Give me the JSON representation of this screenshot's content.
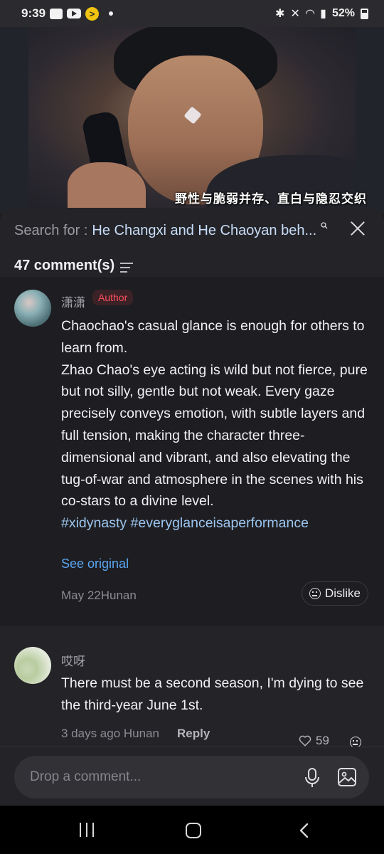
{
  "status_bar": {
    "time": "9:39",
    "battery": "52%"
  },
  "video": {
    "caption": "野性与脆弱并存、直白与隐忍交织"
  },
  "search": {
    "prefix": "Search for :",
    "query": "He Changxi and He Chaoyan beh..."
  },
  "comments_header": {
    "count_label": "47 comment(s)"
  },
  "comments": [
    {
      "username": "潇潇",
      "badge": "Author",
      "paragraph1": "Chaochao's casual glance is enough for others to learn from.",
      "paragraph2": "Zhao Chao's eye acting is wild but not fierce, pure but not silly, gentle but not weak. Every gaze precisely conveys emotion, with subtle layers and full tension, making the character three-dimensional and vibrant, and also elevating the tug-of-war and atmosphere in the scenes with his co-stars to a divine level.",
      "hashtags": "#xidynasty #everyglanceisaperformance",
      "see_original": "See original",
      "meta": "May 22Hunan",
      "dislike_label": "Dislike"
    },
    {
      "username": "哎呀",
      "text": "There must be a second season, I'm dying to see the third-year June 1st.",
      "meta": "3 days ago Hunan",
      "reply_label": "Reply",
      "likes": "59"
    }
  ],
  "input": {
    "placeholder": "Drop a comment..."
  },
  "icons": {
    "close": "close-icon",
    "filter": "filter-icon",
    "heart": "heart-icon",
    "dislike": "dislike-icon",
    "mic": "mic-icon",
    "image": "image-icon",
    "nav": [
      "recents-icon",
      "home-icon",
      "back-icon"
    ]
  },
  "colors": {
    "accent_link": "#5aa6f0",
    "hashtag": "#9cc5ef",
    "author_badge": "#ff4d5e",
    "search_query": "#c7dcf7"
  }
}
